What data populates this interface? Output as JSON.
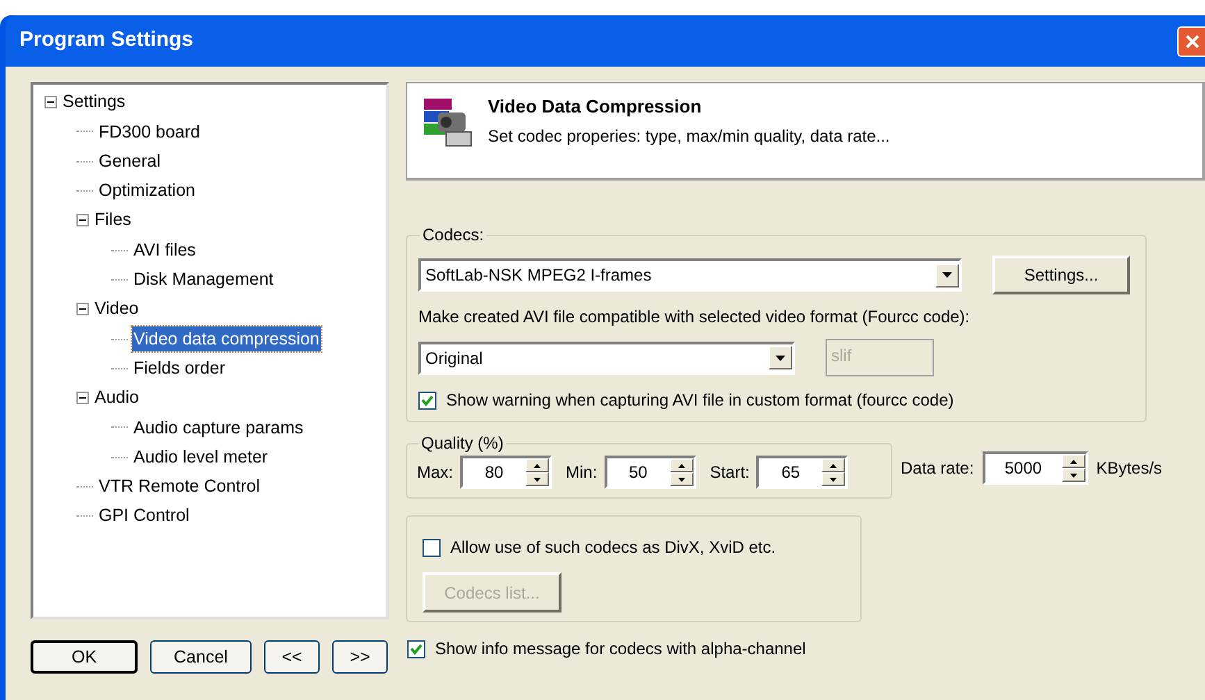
{
  "window": {
    "title": "Program Settings"
  },
  "tree": [
    {
      "label": "Settings",
      "expanded": true,
      "selected": false,
      "children": [
        {
          "label": "FD300 board",
          "selected": false
        },
        {
          "label": "General",
          "selected": false
        },
        {
          "label": "Optimization",
          "selected": false
        },
        {
          "label": "Files",
          "expanded": true,
          "selected": false,
          "children": [
            {
              "label": "AVI files",
              "selected": false
            },
            {
              "label": "Disk Management",
              "selected": false
            }
          ]
        },
        {
          "label": "Video",
          "expanded": true,
          "selected": false,
          "children": [
            {
              "label": "Video data compression",
              "selected": true
            },
            {
              "label": "Fields order",
              "selected": false
            }
          ]
        },
        {
          "label": "Audio",
          "expanded": true,
          "selected": false,
          "children": [
            {
              "label": "Audio capture params",
              "selected": false
            },
            {
              "label": "Audio level meter",
              "selected": false
            }
          ]
        },
        {
          "label": "VTR Remote Control",
          "selected": false
        },
        {
          "label": "GPI Control",
          "selected": false
        }
      ]
    }
  ],
  "buttons": [
    "OK",
    "Cancel",
    "<<",
    ">>"
  ],
  "header": {
    "title": "Video Data Compression",
    "subtitle": "Set codec properies: type, max/min quality, data rate..."
  },
  "codecs": {
    "legend": "Codecs:",
    "codec": "SoftLab-NSK MPEG2 I-frames",
    "settings_button": "Settings...",
    "compat_label": "Make created AVI file compatible with selected video format (Fourcc code):",
    "format": "Original",
    "fourcc": {
      "value": "slif",
      "disabled": true
    },
    "warning": {
      "label": "Show warning when capturing AVI file in custom format (fourcc code)",
      "checked": true
    }
  },
  "quality": {
    "legend": "Quality (%)",
    "spinners": [
      {
        "label": "Max:",
        "value": "80"
      },
      {
        "label": "Min:",
        "value": "50"
      },
      {
        "label": "Start:",
        "value": "65"
      }
    ]
  },
  "data_rate": {
    "label": "Data rate:",
    "value": "5000",
    "unit": "KBytes/s"
  },
  "other_codecs": {
    "allow": {
      "label": "Allow use of such codecs as DivX, XviD etc.",
      "checked": false
    },
    "list_button": {
      "label": "Codecs list...",
      "disabled": true
    }
  },
  "alpha_info": {
    "label": "Show info message for codecs with alpha-channel",
    "checked": true
  }
}
